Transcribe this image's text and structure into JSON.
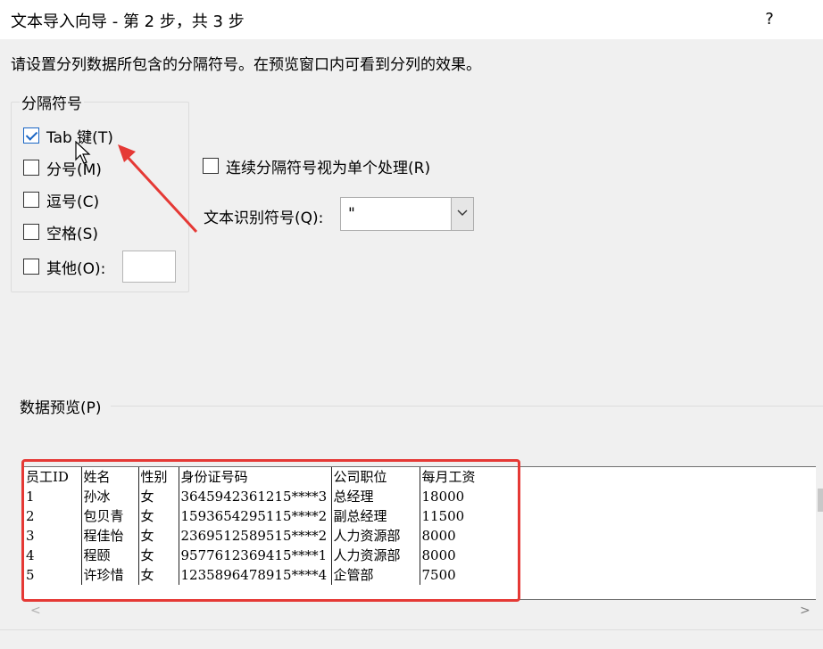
{
  "window": {
    "title": "文本导入向导 - 第 2 步，共 3 步",
    "help": "?"
  },
  "instruction": "请设置分列数据所包含的分隔符号。在预览窗口内可看到分列的效果。",
  "delimiters": {
    "group_title": "分隔符号",
    "tab": {
      "label": "Tab 键(T)",
      "checked": true
    },
    "semicolon": {
      "label": "分号(M)",
      "checked": false
    },
    "comma": {
      "label": "逗号(C)",
      "checked": false
    },
    "space": {
      "label": "空格(S)",
      "checked": false
    },
    "other": {
      "label": "其他(O):",
      "checked": false,
      "value": ""
    }
  },
  "consecutive": {
    "label": "连续分隔符号视为单个处理(R)",
    "checked": false
  },
  "text_qualifier": {
    "label": "文本识别符号(Q):",
    "value": "\""
  },
  "preview": {
    "label": "数据预览(P)",
    "headers": [
      "员工ID",
      "姓名",
      "性别",
      "身份证号码",
      "公司职位",
      "每月工资"
    ],
    "rows": [
      [
        "1",
        "孙冰",
        "女",
        "3645942361215****3",
        "总经理",
        "18000"
      ],
      [
        "2",
        "包贝青",
        "女",
        "1593654295115****2",
        "副总经理",
        "11500"
      ],
      [
        "3",
        "程佳怡",
        "女",
        "2369512589515****2",
        "人力资源部",
        "8000"
      ],
      [
        "4",
        "程颐",
        "女",
        "9577612369415****1",
        "人力资源部",
        "8000"
      ],
      [
        "5",
        "许珍惜",
        "女",
        "1235896478915****4",
        "企管部",
        "7500"
      ]
    ]
  },
  "colors": {
    "annotation": "#e53935",
    "checkbox_accent": "#1a66c5"
  }
}
